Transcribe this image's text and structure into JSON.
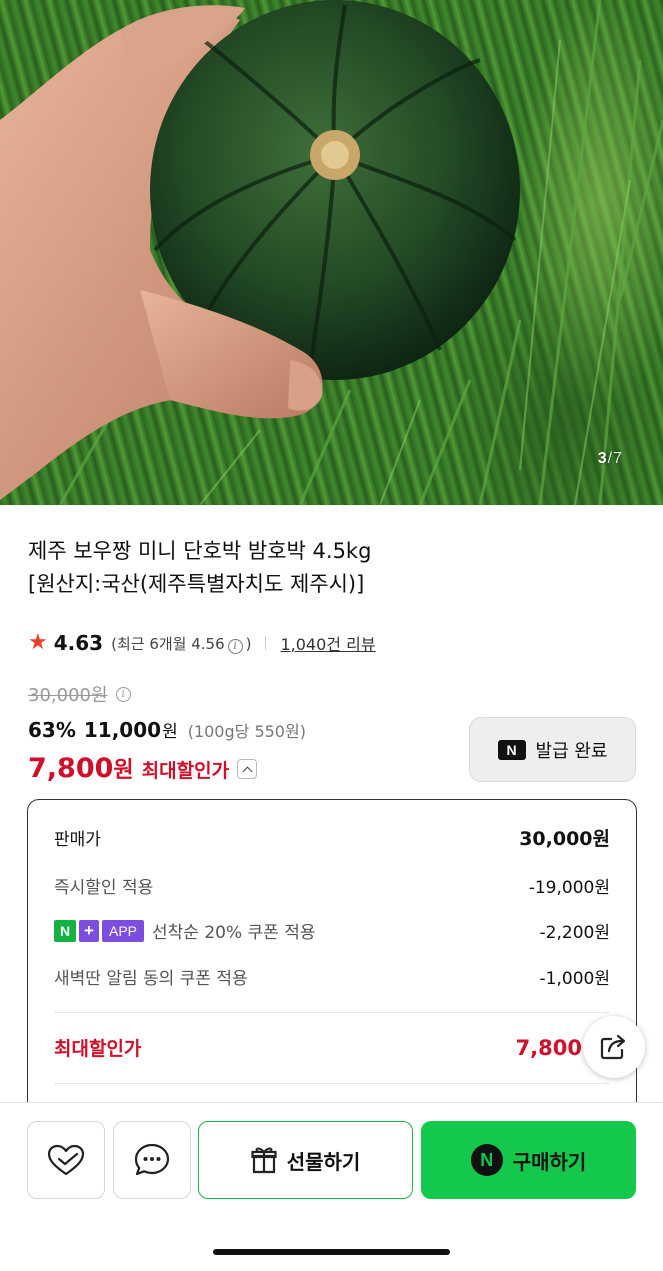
{
  "gallery": {
    "current": "3",
    "separator": "/",
    "total": "7"
  },
  "product": {
    "title_line1": "제주 보우짱 미니 단호박 밤호박 4.5kg",
    "title_line2": "[원산지:국산(제주특별자치도 제주시)]"
  },
  "rating": {
    "score": "4.63",
    "recent_prefix": "(최근 6개월 4.56",
    "recent_suffix": ")",
    "reviews": "1,040건 리뷰"
  },
  "price": {
    "original": "30,000원",
    "discount_rate": "63%",
    "sale_price": "11,000",
    "sale_unit": "원",
    "unit_price": "(100g당 550원)",
    "max_price": "7,800",
    "max_unit": "원",
    "max_label": "최대할인가"
  },
  "coupon": {
    "icon_text": "N",
    "label": "발급 완료"
  },
  "breakdown": {
    "rows": [
      {
        "label": "판매가",
        "value": "30,000원"
      },
      {
        "label": "즉시할인 적용",
        "value": "-19,000원"
      },
      {
        "label": "선착순 20% 쿠폰 적용",
        "value": "-2,200원"
      },
      {
        "label": "새벽딴 알림 동의 쿠폰 적용",
        "value": "-1,000원"
      }
    ],
    "badges": [
      "N",
      "+",
      "APP"
    ],
    "total_label": "최대할인가",
    "total_value": "7,800"
  },
  "bottom_bar": {
    "gift_label": "선물하기",
    "buy_label": "구매하기",
    "buy_icon_text": "N"
  },
  "colors": {
    "accent_red": "#d0102a",
    "naver_green": "#13c84b",
    "badge_purple": "#7b4ee0",
    "star": "#e8422f"
  }
}
